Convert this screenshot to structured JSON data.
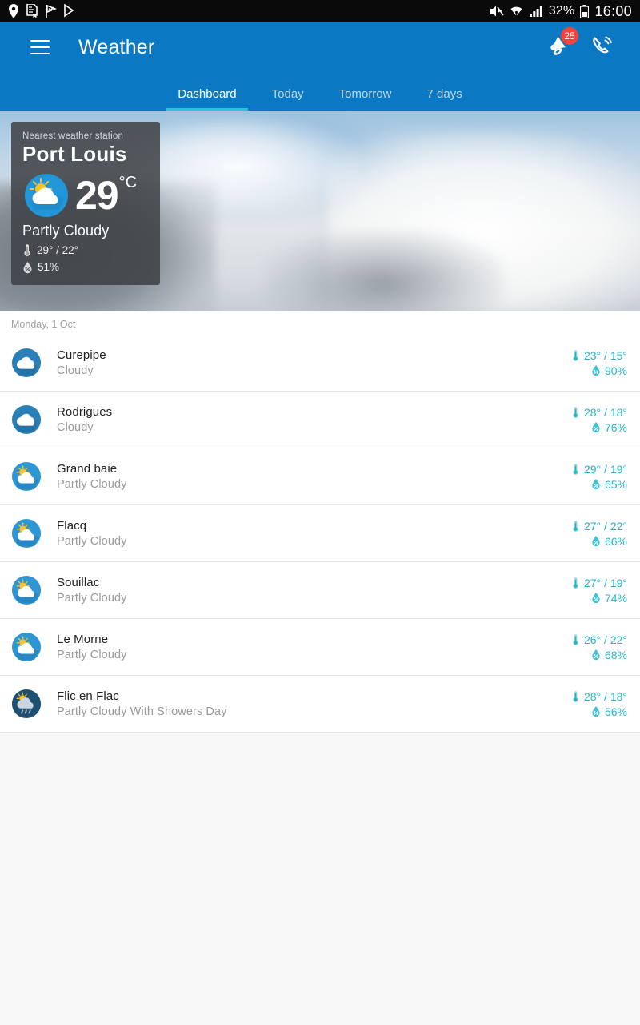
{
  "status_bar": {
    "icons": [
      "location-icon",
      "document-x-icon",
      "flag-icon",
      "play-store-icon"
    ],
    "mute_icon": "mute-icon",
    "wifi_icon": "wifi-icon",
    "signal_icon": "signal-icon",
    "battery_percent": "32%",
    "battery_icon": "battery-icon",
    "clock": "16:00"
  },
  "appbar": {
    "menu_icon": "hamburger-menu-icon",
    "title": "Weather",
    "announcement_icon": "megaphone-icon",
    "announcement_badge": "25",
    "call_icon": "phone-ring-icon",
    "accent_color": "#0a78c2",
    "tab_indicator_color": "#26c6da"
  },
  "tabs": [
    {
      "label": "Dashboard",
      "active": true
    },
    {
      "label": "Today",
      "active": false
    },
    {
      "label": "Tomorrow",
      "active": false
    },
    {
      "label": "7 days",
      "active": false
    }
  ],
  "station_card": {
    "label": "Nearest weather station",
    "name": "Port Louis",
    "icon": "partly-cloudy-icon",
    "temperature": "29",
    "unit": "°C",
    "condition": "Partly Cloudy",
    "temp_range": "29° / 22°",
    "humidity": "51%",
    "thermometer_icon": "thermometer-icon",
    "humidity_icon": "humidity-droplet-icon"
  },
  "list": {
    "date_label": "Monday, 1 Oct",
    "accent_color": "#23b6c7",
    "rows": [
      {
        "city": "Curepipe",
        "condition": "Cloudy",
        "temp_range": "23° / 15°",
        "humidity": "90%",
        "icon": "cloudy-icon"
      },
      {
        "city": "Rodrigues",
        "condition": "Cloudy",
        "temp_range": "28° / 18°",
        "humidity": "76%",
        "icon": "cloudy-icon"
      },
      {
        "city": "Grand baie",
        "condition": "Partly Cloudy",
        "temp_range": "29° / 19°",
        "humidity": "65%",
        "icon": "partly-cloudy-icon"
      },
      {
        "city": "Flacq",
        "condition": "Partly Cloudy",
        "temp_range": "27° / 22°",
        "humidity": "66%",
        "icon": "partly-cloudy-icon"
      },
      {
        "city": "Souillac",
        "condition": "Partly Cloudy",
        "temp_range": "27° / 19°",
        "humidity": "74%",
        "icon": "partly-cloudy-icon"
      },
      {
        "city": "Le Morne",
        "condition": "Partly Cloudy",
        "temp_range": "26° / 22°",
        "humidity": "68%",
        "icon": "partly-cloudy-icon"
      },
      {
        "city": "Flic en Flac",
        "condition": "Partly Cloudy With Showers Day",
        "temp_range": "28° / 18°",
        "humidity": "56%",
        "icon": "partly-cloudy-showers-icon"
      }
    ]
  }
}
